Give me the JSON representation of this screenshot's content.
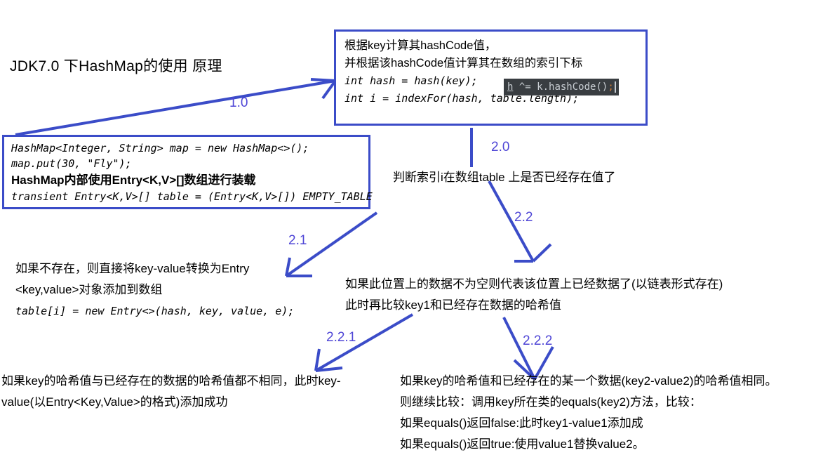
{
  "page": {
    "title": "JDK7.0 下HashMap的使用 原理",
    "accent_color": "#3b4cc8",
    "step_label_color": "#4f46d6",
    "code_chip_bg": "#393d41",
    "code_chip_fg": "#c8cdd2",
    "code_chip_accent": "#cc7832",
    "background": "#ffffff"
  },
  "boxes": {
    "hash_box": {
      "line1": "根据key计算其hashCode值，",
      "line2": "并根据该hashCode值计算其在数组的索引下标",
      "code1": "int hash = hash(key);",
      "code2": "int i = indexFor(hash, table.length);",
      "chip": {
        "var": "h",
        "op": " ^= ",
        "call": "k.hashCode()",
        "semicolon": ";"
      }
    },
    "map_box": {
      "code1": "HashMap<Integer, String> map = new HashMap<>();",
      "code2": "map.put(30, \"Fly\");",
      "note": "HashMap内部使用Entry<K,V>[]数组进行装载",
      "code3": "transient Entry<K,V>[] table = (Entry<K,V>[]) EMPTY_TABLE"
    }
  },
  "texts": {
    "check_index": "判断索引i在数组table 上是否已经存在值了",
    "not_exist": {
      "line1": "如果不存在，则直接将key-value转换为Entry",
      "line2": "<key,value>对象添加到数组",
      "code": "table[i] = new Entry<>(hash, key, value, e);"
    },
    "exists": {
      "line1": "如果此位置上的数据不为空则代表该位置上已经数据了(以链表形式存在)",
      "line2": "此时再比较key1和已经存在数据的哈希值"
    },
    "hash_differ": {
      "line1": "如果key的哈希值与已经存在的数据的哈希值都不相同，此时key-",
      "line2": "value(以Entry<Key,Value>的格式)添加成功"
    },
    "hash_same": {
      "line1": "如果key的哈希值和已经存在的某一个数据(key2-value2)的哈希值相同。",
      "line2": "则继续比较：调用key所在类的equals(key2)方法，比较：",
      "line3": "如果equals()返回false:此时key1-value1添加成",
      "line4": "如果equals()返回true:使用value1替换value2。"
    }
  },
  "steps": [
    {
      "id": "step-1-0",
      "label": "1.0"
    },
    {
      "id": "step-2-0",
      "label": "2.0"
    },
    {
      "id": "step-2-1",
      "label": "2.1"
    },
    {
      "id": "step-2-2",
      "label": "2.2"
    },
    {
      "id": "step-2-2-1",
      "label": "2.2.1"
    },
    {
      "id": "step-2-2-2",
      "label": "2.2.2"
    }
  ]
}
